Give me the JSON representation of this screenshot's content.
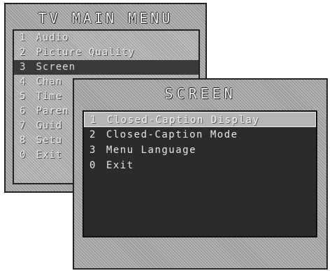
{
  "main_menu": {
    "title": "TV MAIN MENU",
    "items": [
      {
        "num": "1",
        "label": "Audio"
      },
      {
        "num": "2",
        "label": "Picture Quality"
      },
      {
        "num": "3",
        "label": "Screen"
      },
      {
        "num": "4",
        "label": "Chan"
      },
      {
        "num": "5",
        "label": "Time"
      },
      {
        "num": "6",
        "label": "Paren"
      },
      {
        "num": "7",
        "label": "Guid"
      },
      {
        "num": "8",
        "label": "Setu"
      },
      {
        "num": "0",
        "label": "Exit"
      }
    ],
    "selected_index": 2
  },
  "screen_menu": {
    "title": "SCREEN",
    "items": [
      {
        "num": "1",
        "label": "Closed-Caption Display"
      },
      {
        "num": "2",
        "label": "Closed-Caption Mode"
      },
      {
        "num": "3",
        "label": "Menu Language"
      },
      {
        "num": "0",
        "label": "Exit"
      }
    ],
    "selected_index": 0
  }
}
